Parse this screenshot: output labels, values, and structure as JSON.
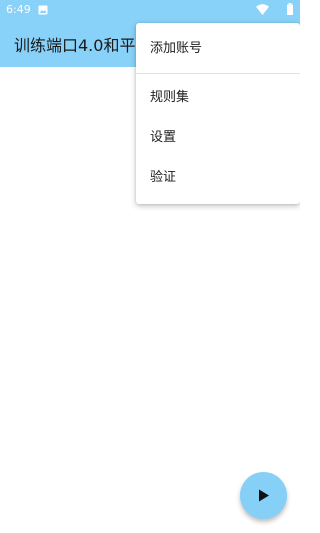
{
  "status_bar": {
    "time": "6:49",
    "icons": [
      "image-icon",
      "wifi-icon",
      "battery-icon"
    ]
  },
  "app_bar": {
    "title": "训练端口4.0和平"
  },
  "overflow_menu": {
    "items": [
      {
        "label": "添加账号"
      },
      {
        "label": "规则集"
      },
      {
        "label": "设置"
      },
      {
        "label": "验证"
      }
    ]
  },
  "fab": {
    "icon": "play-icon"
  },
  "colors": {
    "header": "#88d1f9",
    "fab": "#86cff7",
    "background": "#ffffff"
  }
}
